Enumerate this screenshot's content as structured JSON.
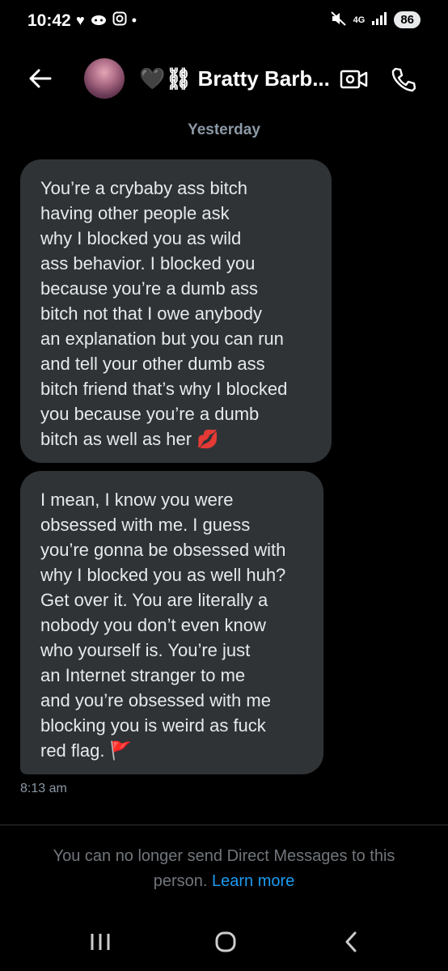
{
  "status": {
    "time": "10:42",
    "network": "4G",
    "battery": "86"
  },
  "header": {
    "name": "🖤⛓ Bratty Barb..."
  },
  "conversation": {
    "date_separator": "Yesterday",
    "messages": [
      {
        "text": "You’re a crybaby ass bitch\nhaving other people ask\nwhy I blocked you as wild\nass behavior. I blocked you\nbecause you’re a dumb ass\nbitch not that I owe anybody\nan explanation but you can run\nand tell your other dumb ass\nbitch friend that’s why I blocked\nyou because you’re a dumb\nbitch as well as her 💋"
      },
      {
        "text": "I mean, I know you were\nobsessed with me. I guess\nyou’re gonna be obsessed with\nwhy I blocked you as well huh?\nGet over it. You are literally a\nnobody you don’t even know\nwho yourself is. You’re just\nan Internet stranger to me\nand you’re obsessed with me\nblocking you is weird as fuck\nred flag. 🚩"
      }
    ],
    "timestamp": "8:13 am"
  },
  "footer": {
    "notice": "You can no longer send Direct Messages to this person.",
    "learn_more": "Learn more"
  }
}
